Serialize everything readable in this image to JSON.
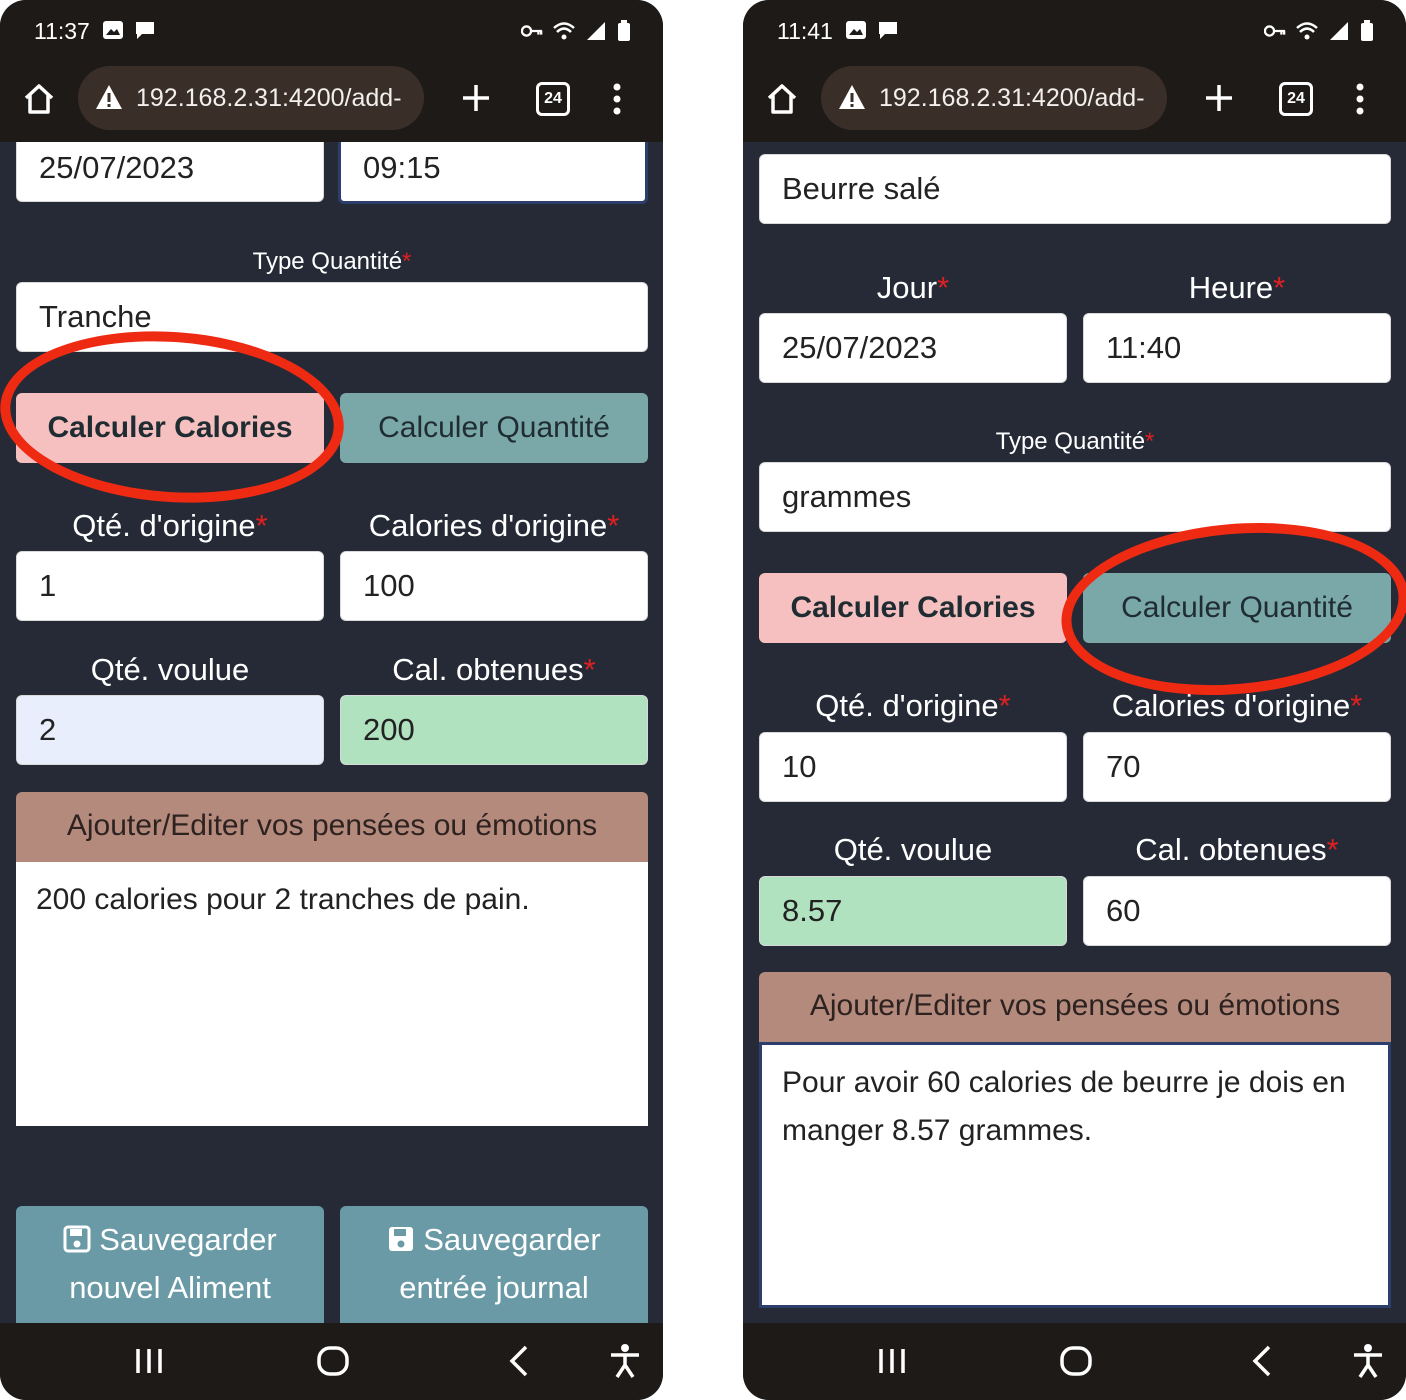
{
  "left": {
    "status": {
      "time": "11:37"
    },
    "url": "192.168.2.31:4200/add-",
    "tab_count": "24",
    "date_value": "25/07/2023",
    "time_value": "09:15",
    "type_quantite_label": "Type Quantité",
    "type_quantite_value": "Tranche",
    "btn_calc_calories": "Calculer Calories",
    "btn_calc_quantite": "Calculer Quantité",
    "qte_origine_label": "Qté. d'origine",
    "qte_origine_value": "1",
    "calories_origine_label": "Calories d'origine",
    "calories_origine_value": "100",
    "qte_voulue_label": "Qté. voulue",
    "qte_voulue_value": "2",
    "cal_obtenues_label": "Cal. obtenues",
    "cal_obtenues_value": "200",
    "notes_header": "Ajouter/Editer vos pensées ou émotions",
    "notes_text": "200 calories pour 2 tranches de pain.",
    "save_aliment_line1": "Sauvegarder",
    "save_aliment_line2": "nouvel Aliment",
    "save_journal_line1": "Sauvegarder",
    "save_journal_line2": "entrée journal"
  },
  "right": {
    "status": {
      "time": "11:41"
    },
    "url": "192.168.2.31:4200/add-",
    "tab_count": "24",
    "aliment_value": "Beurre salé",
    "jour_label": "Jour",
    "heure_label": "Heure",
    "date_value": "25/07/2023",
    "time_value": "11:40",
    "type_quantite_label": "Type Quantité",
    "type_quantite_value": "grammes",
    "btn_calc_calories": "Calculer Calories",
    "btn_calc_quantite": "Calculer Quantité",
    "qte_origine_label": "Qté. d'origine",
    "qte_origine_value": "10",
    "calories_origine_label": "Calories d'origine",
    "calories_origine_value": "70",
    "qte_voulue_label": "Qté. voulue",
    "qte_voulue_value": "8.57",
    "cal_obtenues_label": "Cal. obtenues",
    "cal_obtenues_value": "60",
    "notes_header": "Ajouter/Editer vos pensées ou émotions",
    "notes_text": "Pour avoir 60 calories de beurre je dois en manger 8.57 grammes."
  },
  "required_mark": "*",
  "colors": {
    "annotation_circle": "#ef2a12",
    "btn_calories": "#f6c0c0",
    "btn_quantite": "#7aa7a8",
    "result_field": "#b1e2c0",
    "notes_header": "#b48a7c",
    "save_button": "#6a9aa6"
  }
}
